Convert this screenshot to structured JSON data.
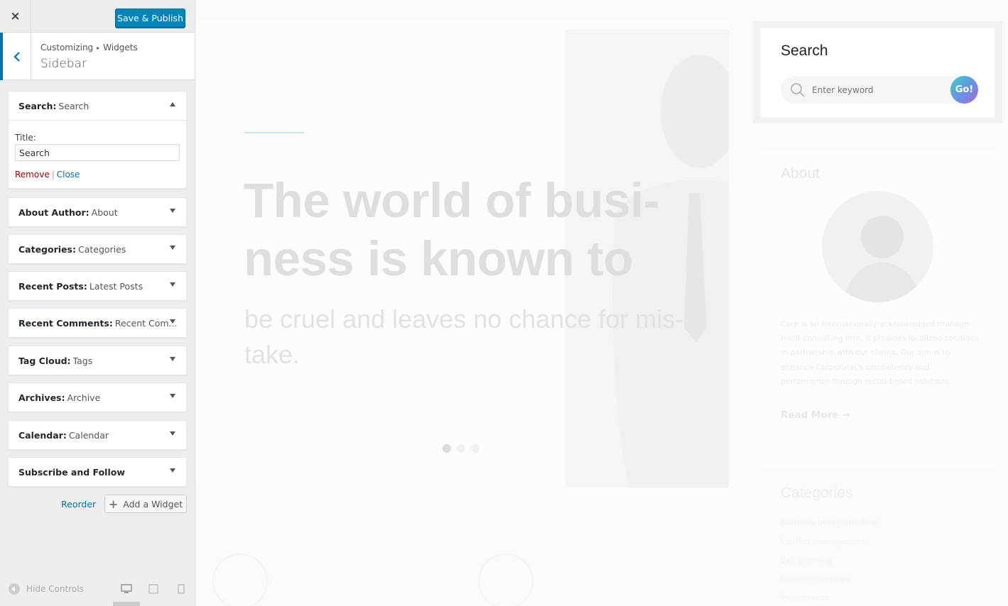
{
  "customizer": {
    "close_icon": "×",
    "publish_label": "Save & Publish",
    "breadcrumb": {
      "part1": "Customizing",
      "separator": "▸",
      "part2": "Widgets"
    },
    "section_title": "Sidebar",
    "expanded_widget": {
      "type": "Search:",
      "name": "Search",
      "title_label": "Title:",
      "title_value": "Search",
      "remove_label": "Remove",
      "separator": "|",
      "close_label": "Close"
    },
    "widgets": [
      {
        "type": "About Author:",
        "name": "About"
      },
      {
        "type": "Categories:",
        "name": "Categories"
      },
      {
        "type": "Recent Posts:",
        "name": "Latest Posts"
      },
      {
        "type": "Recent Comments:",
        "name": "Recent Com..."
      },
      {
        "type": "Tag Cloud:",
        "name": "Tags"
      },
      {
        "type": "Archives:",
        "name": "Archive"
      },
      {
        "type": "Calendar:",
        "name": "Calendar"
      },
      {
        "type": "Subscribe and Follow",
        "name": ""
      }
    ],
    "reorder_label": "Reorder",
    "add_widget_label": "Add a Widget",
    "hide_controls_label": "Hide Controls",
    "accent_color": "#0073aa",
    "publish_color": "#0085ba"
  },
  "preview": {
    "hero_title": "The world of busi-ness is known to",
    "hero_title_line1": "The world of busi-",
    "hero_title_line2": "ness is known to",
    "hero_sub_line1": "be cruel and leaves no chance for mis-",
    "hero_sub_line2": "take.",
    "search_widget_title": "Search",
    "search_placeholder": "Enter keyword",
    "go_label": "Go!",
    "about_title": "About",
    "about_text": "Corp is an internationally acknowledged manage-ment consulting firm. It provides localized solutions in partnership with our clients. Our aim is to enhance Corporate\\'s competency and performance through result-based solutions.",
    "read_more_label": "Read More →",
    "categories_title": "Categories",
    "categories": [
      "Business plan consulting",
      "Conflict management",
      "Exit planning",
      "Financial services",
      "Investments"
    ]
  }
}
